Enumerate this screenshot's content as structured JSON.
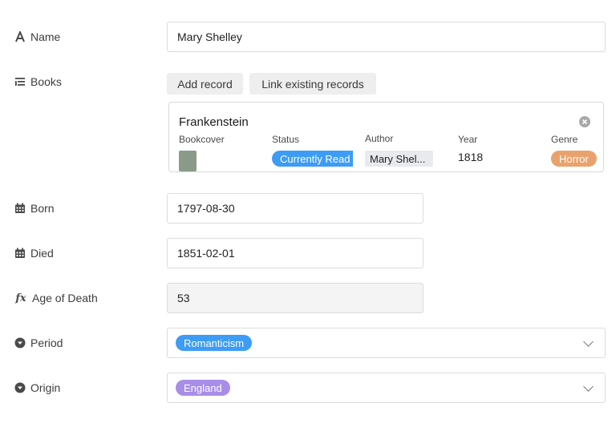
{
  "fields": {
    "name": {
      "label": "Name",
      "value": "Mary Shelley",
      "icon": "text-icon"
    },
    "books": {
      "label": "Books",
      "icon": "list-icon"
    },
    "born": {
      "label": "Born",
      "value": "1797-08-30",
      "icon": "calendar-icon"
    },
    "died": {
      "label": "Died",
      "value": "1851-02-01",
      "icon": "calendar-icon"
    },
    "age_of_death": {
      "label": "Age of Death",
      "value": "53",
      "icon": "formula-icon"
    },
    "period": {
      "label": "Period",
      "value": "Romanticism",
      "icon": "single-select-icon"
    },
    "origin": {
      "label": "Origin",
      "value": "England",
      "icon": "single-select-icon"
    }
  },
  "books_actions": {
    "add_record": "Add record",
    "link_existing": "Link existing records"
  },
  "book_card": {
    "title": "Frankenstein",
    "columns": {
      "bookcover": "Bookcover",
      "status": "Status",
      "author": "Author",
      "year": "Year",
      "genre": "Genre"
    },
    "values": {
      "status": "Currently Read",
      "author": "Mary Shel...",
      "year": "1818",
      "genre": "Horror"
    }
  },
  "colors": {
    "status_pill": "#3d9cf5",
    "genre_pill": "#e9a26d",
    "period_pill": "#3d9cf5",
    "origin_pill": "#a98ee8",
    "author_chip": "#e8eaee",
    "cover_thumb": "#8a9a8a"
  }
}
